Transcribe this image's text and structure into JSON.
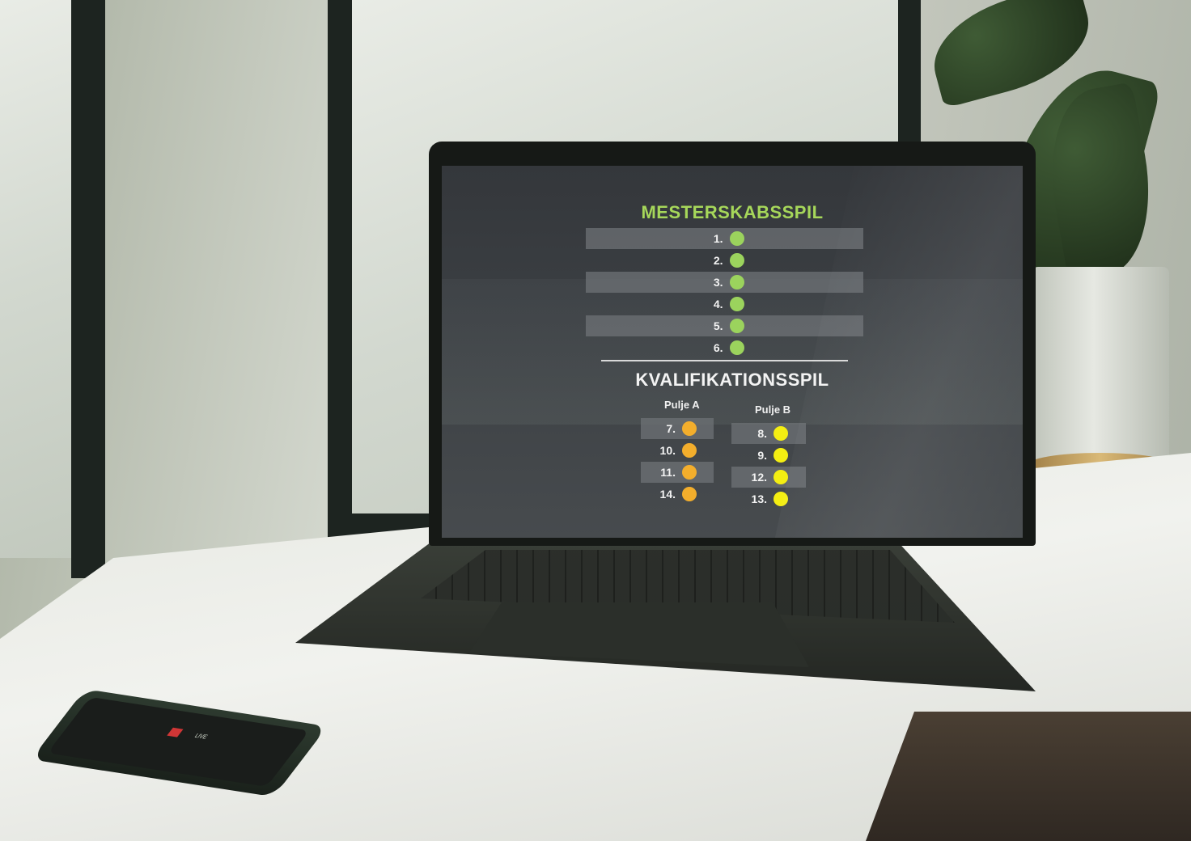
{
  "screen": {
    "championship": {
      "title": "MESTERSKABSSPIL",
      "rows": [
        "1.",
        "2.",
        "3.",
        "4.",
        "5.",
        "6."
      ]
    },
    "qualification": {
      "title": "KVALIFIKATIONSSPIL",
      "pool_a": {
        "label": "Pulje A",
        "rows": [
          "7.",
          "10.",
          "11.",
          "14."
        ]
      },
      "pool_b": {
        "label": "Pulje B",
        "rows": [
          "8.",
          "9.",
          "12.",
          "13."
        ]
      }
    }
  },
  "phone": {
    "screen_text": "LIVE"
  },
  "colors": {
    "green": "#9bd35d",
    "orange": "#f3ae2c",
    "yellow": "#f4ee12",
    "title_green": "#a6d75a"
  }
}
